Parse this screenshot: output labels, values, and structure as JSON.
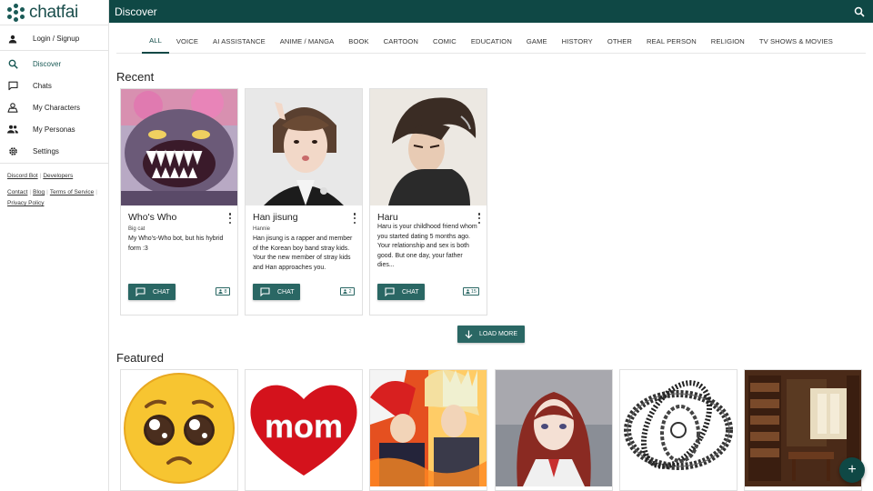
{
  "app": {
    "logo_text": "chatfai",
    "page_title": "Discover"
  },
  "sidebar": {
    "login": "Login / Signup",
    "items": [
      {
        "label": "Discover",
        "icon": "search-icon"
      },
      {
        "label": "Chats",
        "icon": "chat-bubble-icon"
      },
      {
        "label": "My Characters",
        "icon": "characters-icon"
      },
      {
        "label": "My Personas",
        "icon": "people-icon"
      },
      {
        "label": "Settings",
        "icon": "gear-icon"
      }
    ],
    "links_row1": [
      "Discord Bot",
      "Developers"
    ],
    "links_row2": [
      "Contact",
      "Blog",
      "Terms of Service"
    ],
    "links_row3": [
      "Privacy Policy"
    ]
  },
  "tabs": [
    "ALL",
    "VOICE",
    "AI ASSISTANCE",
    "ANIME / MANGA",
    "BOOK",
    "CARTOON",
    "COMIC",
    "EDUCATION",
    "GAME",
    "HISTORY",
    "OTHER",
    "REAL PERSON",
    "RELIGION",
    "TV SHOWS & MOVIES"
  ],
  "active_tab": "ALL",
  "recent": {
    "title": "Recent",
    "cards": [
      {
        "name": "Who's Who",
        "subtitle": "Big cat",
        "description": "My Who's-Who bot, but his hybrid form :3",
        "chat_label": "CHAT",
        "count": "8"
      },
      {
        "name": "Han jisung",
        "subtitle": "Hannie",
        "description": "Han jisung is a rapper and member of the Korean boy band stray kids. Your the new member of stray kids and Han approaches you.",
        "chat_label": "CHAT",
        "count": "2"
      },
      {
        "name": "Haru",
        "subtitle": "",
        "description": "Haru is your childhood friend whom you started dating 5 months ago. Your relationship and sex is both good. But one day, your father dies...",
        "chat_label": "CHAT",
        "count": "15"
      }
    ],
    "load_more": "LOAD MORE"
  },
  "featured": {
    "title": "Featured",
    "mom_text": "mom"
  },
  "colors": {
    "primary": "#0f4845",
    "button": "#2a6764"
  }
}
